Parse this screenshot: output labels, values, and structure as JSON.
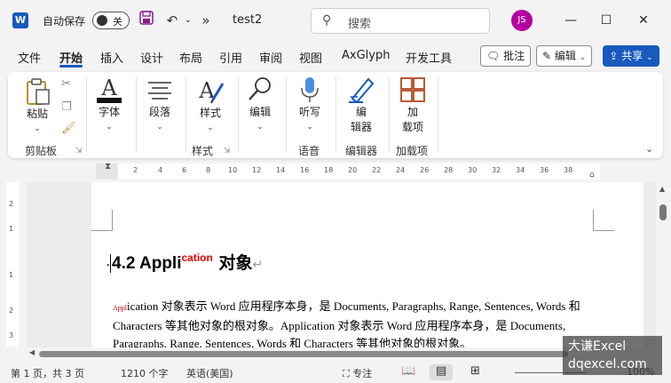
{
  "titlebar": {
    "autosave_label": "自动保存",
    "autosave_state": "关",
    "doc_title": "test2",
    "more": "»",
    "search_placeholder": "搜索",
    "avatar_initials": "JS"
  },
  "tabs": [
    "文件",
    "开始",
    "插入",
    "设计",
    "布局",
    "引用",
    "审阅",
    "视图",
    "AxGlyph",
    "开发工具"
  ],
  "actions": {
    "comments": "批注",
    "editing": "编辑",
    "share": "共享"
  },
  "ribbon": {
    "paste": "粘贴",
    "font": "字体",
    "paragraph": "段落",
    "styles": "样式",
    "editing": "编辑",
    "dictate": "听写",
    "editor_line1": "编",
    "editor_line2": "辑器",
    "addins_line1": "加",
    "addins_line2": "载项",
    "groups": {
      "clipboard": "剪贴板",
      "styles": "样式",
      "voice": "语音",
      "editor": "编辑器",
      "addins": "加载项"
    }
  },
  "ruler": [
    "2",
    "4",
    "6",
    "8",
    "10",
    "12",
    "14",
    "16",
    "18",
    "20",
    "22",
    "24",
    "26",
    "28",
    "30",
    "32",
    "34",
    "36",
    "38"
  ],
  "vruler": [
    "2",
    "1",
    "1",
    "2",
    "3"
  ],
  "document": {
    "heading_main": "4.2 Appli",
    "heading_sup": "cation",
    "heading_tail": "  对象",
    "para_mark": "↵",
    "body_prefix": "Appl",
    "body_text": "ication 对象表示 Word 应用程序本身，是 Documents, Paragraphs, Range, Sentences, Words 和 Characters 等其他对象的根对象。Application 对象表示 Word 应用程序本身，是 Documents, Paragraphs, Range, Sentences, Words 和 Characters 等其他对象的根对象。"
  },
  "status": {
    "page": "第 1 页，共 3 页",
    "words": "1210 个字",
    "language": "英语(美国)",
    "focus": "专注",
    "zoom": "100%"
  },
  "watermark": {
    "line1": "大谦Excel",
    "line2": "dqexcel.com"
  }
}
